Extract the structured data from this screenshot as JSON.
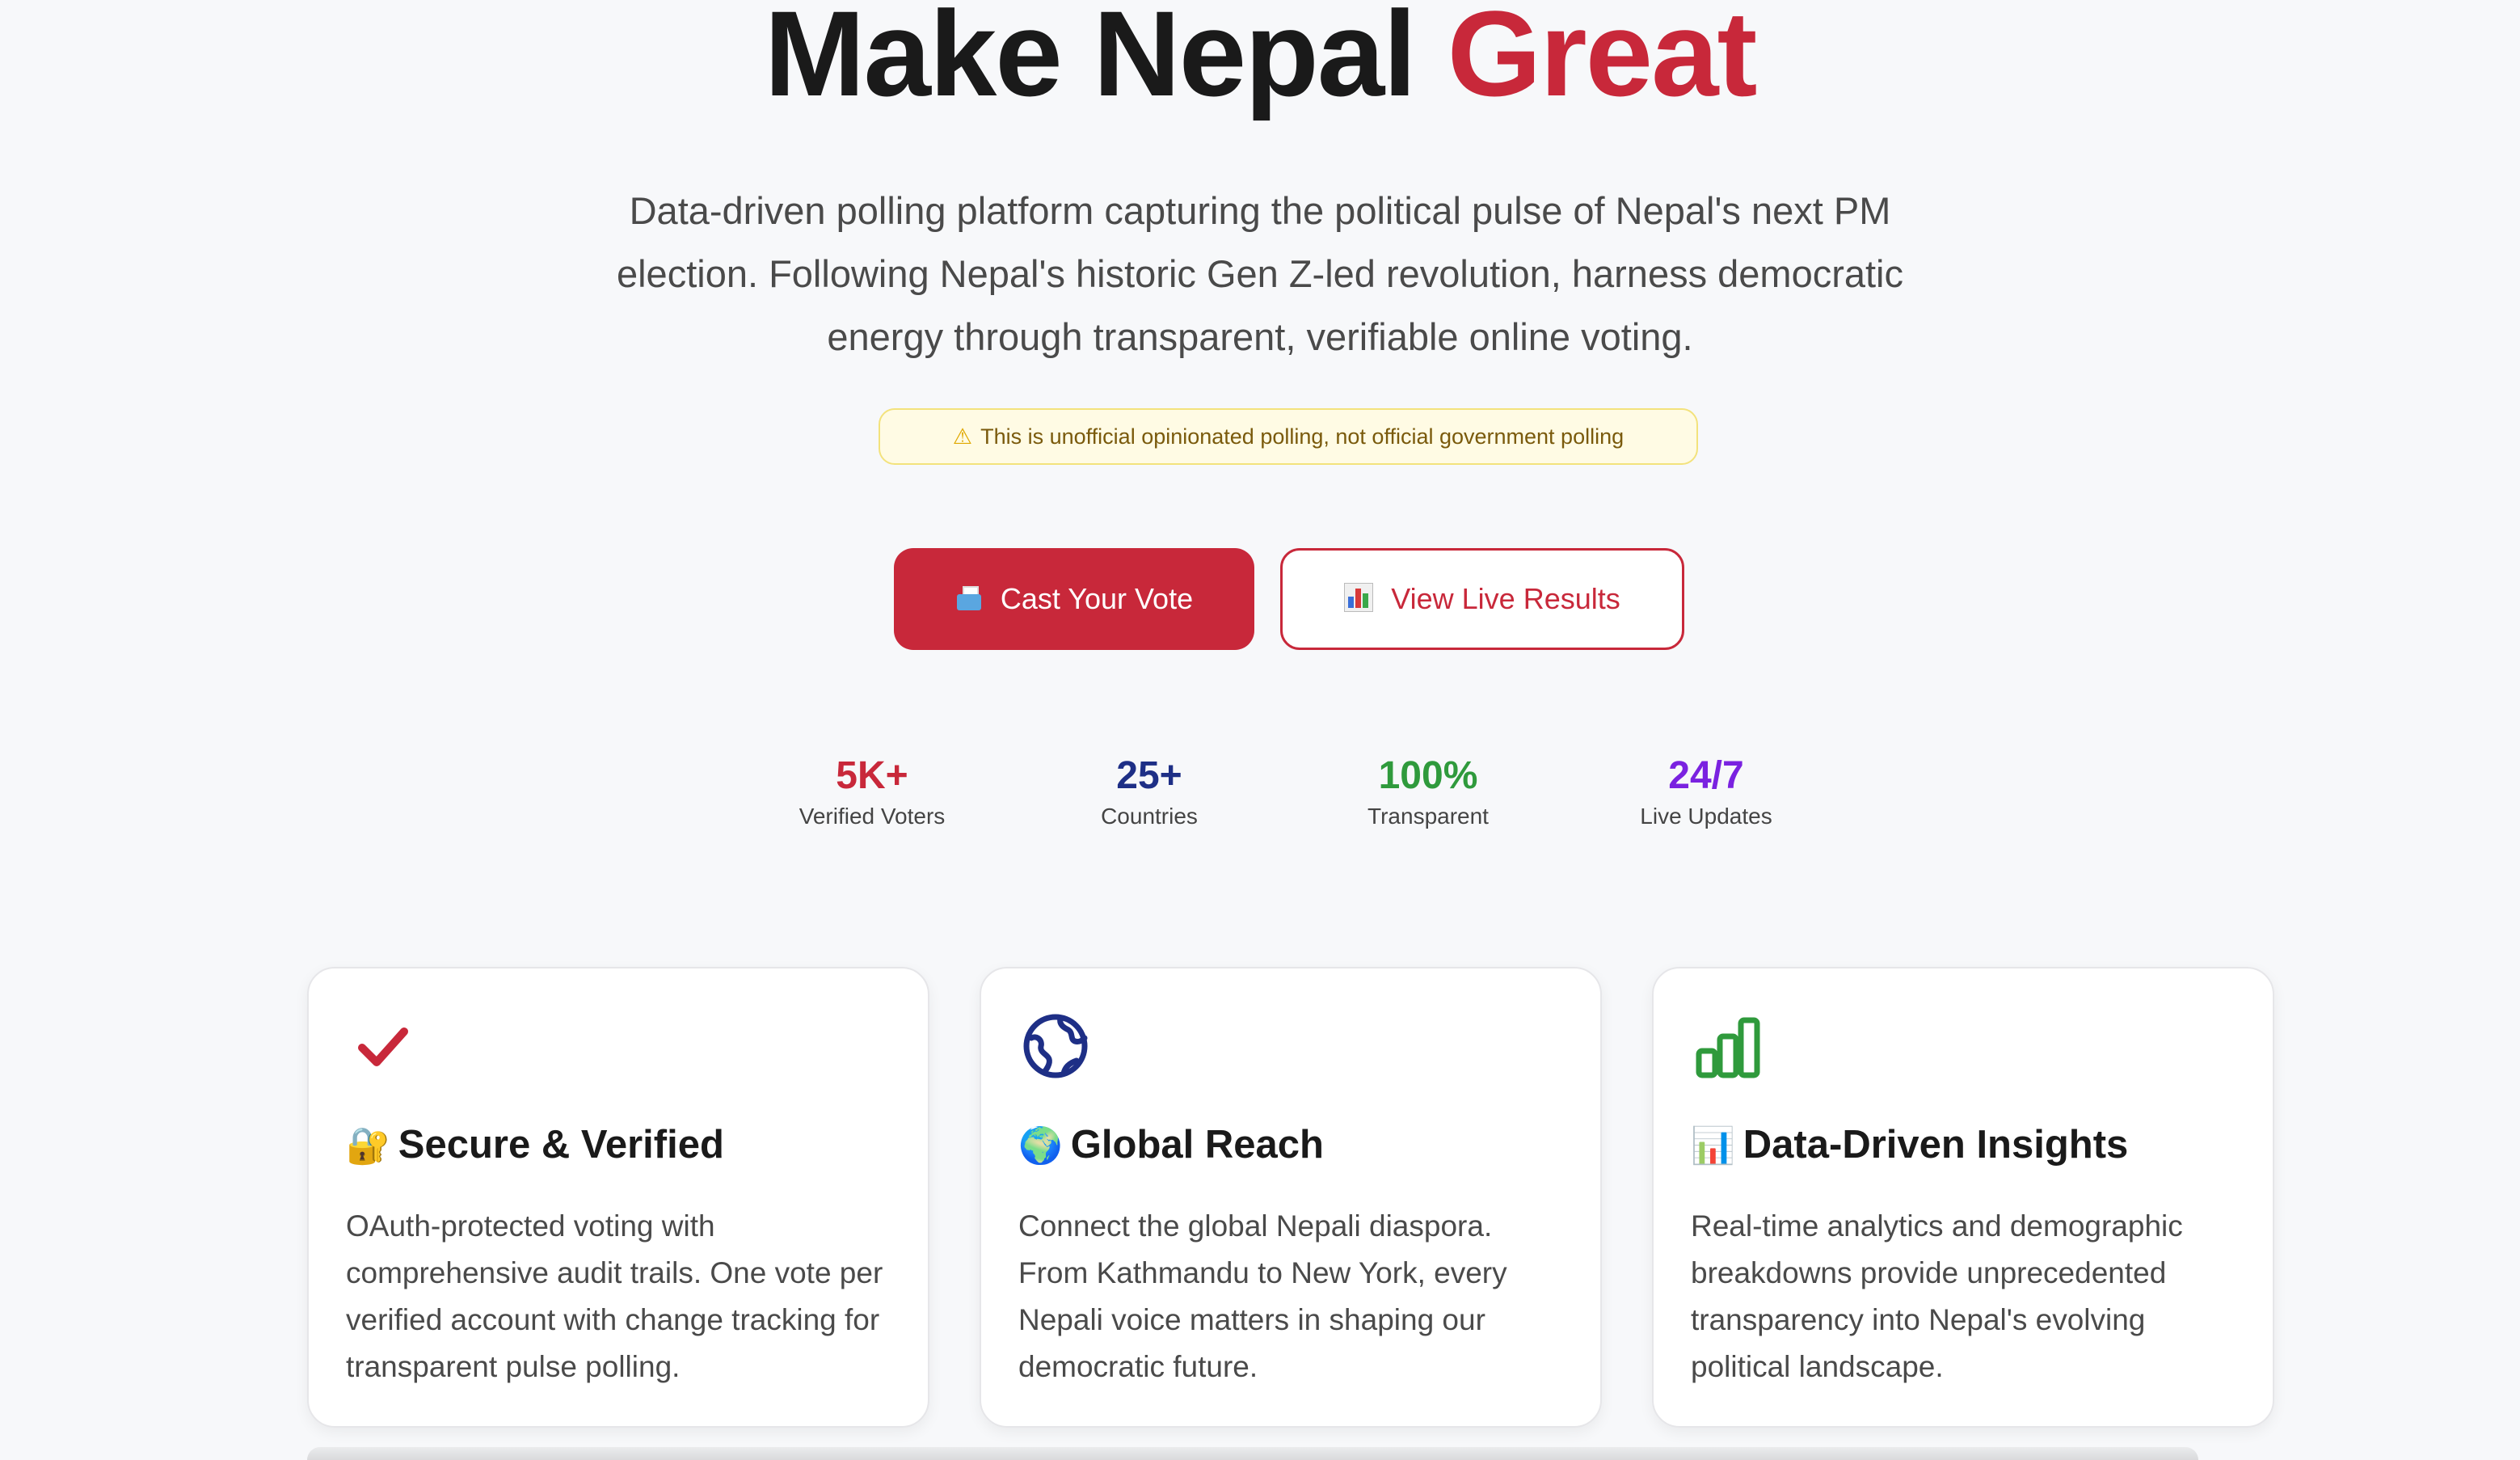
{
  "hero": {
    "title_main": "Make Nepal",
    "title_accent": "Great",
    "subtitle": "Data-driven polling platform capturing the political pulse of Nepal's next PM election. Following Nepal's historic Gen Z-led revolution, harness democratic energy through transparent, verifiable online voting.",
    "disclaimer": "This is unofficial opinionated polling, not official government polling",
    "disclaimer_icon": "warning-icon"
  },
  "actions": {
    "primary_label": "Cast Your Vote",
    "primary_icon": "ballot-box-icon",
    "secondary_label": "View Live Results",
    "secondary_icon": "bar-chart-icon"
  },
  "stats": [
    {
      "value": "5K+",
      "label": "Verified Voters",
      "color": "#c8283a"
    },
    {
      "value": "25+",
      "label": "Countries",
      "color": "#1e2f86"
    },
    {
      "value": "100%",
      "label": "Transparent",
      "color": "#2f9a3c"
    },
    {
      "value": "24/7",
      "label": "Live Updates",
      "color": "#7a22e0"
    }
  ],
  "features": [
    {
      "icon": "checkmark-icon",
      "emoji": "🔐",
      "title": "Secure & Verified",
      "body": "OAuth-protected voting with comprehensive audit trails. One vote per verified account with change tracking for transparent pulse polling."
    },
    {
      "icon": "globe-icon",
      "emoji": "🌍",
      "title": "Global Reach",
      "body": "Connect the global Nepali diaspora. From Kathmandu to New York, every Nepali voice matters in shaping our democratic future."
    },
    {
      "icon": "bar-chart-icon",
      "emoji": "📊",
      "title": "Data-Driven Insights",
      "body": "Real-time analytics and demographic breakdowns provide unprecedented transparency into Nepal's evolving political landscape."
    }
  ],
  "colors": {
    "brand": "#c8283a",
    "navy": "#1e2f86",
    "green": "#2f9a3c",
    "purple": "#7a22e0"
  }
}
